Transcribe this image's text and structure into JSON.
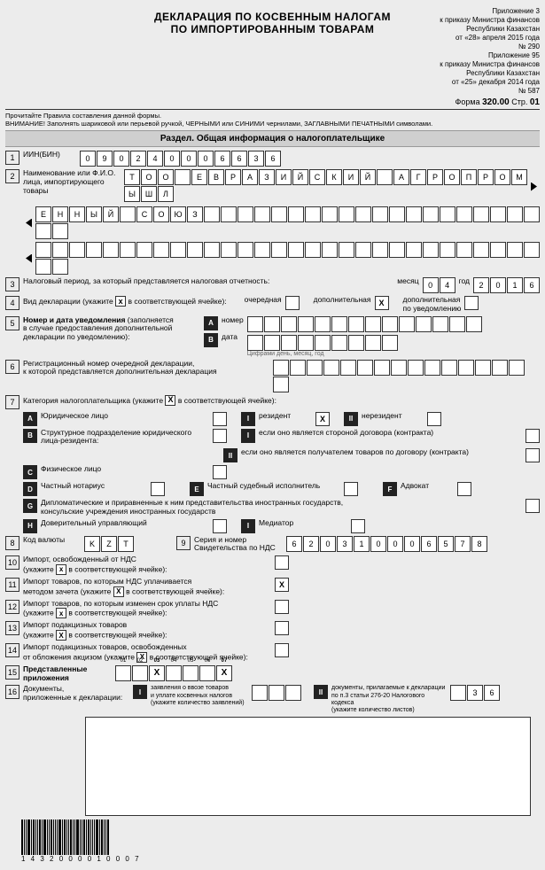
{
  "header": {
    "title_line1": "ДЕКЛАРАЦИЯ ПО КОСВЕННЫМ НАЛОГАМ",
    "title_line2": "ПО ИМПОРТИРОВАННЫМ ТОВАРАМ",
    "annex": "Приложение 3",
    "to1": "к приказу Министра финансов",
    "to2": "Республики Казахстан",
    "date1": "от «28» апреля 2015 года",
    "num1": "№ 290",
    "annex2": "Приложение 95",
    "to3": "к приказу Министра финансов",
    "to4": "Республики Казахстан",
    "date2": "от «25» декабря 2014 года",
    "num2": "№ 587",
    "form_label": "Форма",
    "form_code": "320.00",
    "page_label": "Стр.",
    "page": "01"
  },
  "notes": {
    "l1": "Прочитайте Правила составления данной формы.",
    "l2": "ВНИМАНИЕ! Заполнять шариковой или перьевой ручкой, ЧЕРНЫМИ или СИНИМИ чернилами, ЗАГЛАВНЫМИ ПЕЧАТНЫМИ символами."
  },
  "section": {
    "title": "Раздел. Общая информация о налогоплательщике"
  },
  "r1": {
    "label": "ИИН(БИН)",
    "v": [
      "0",
      "9",
      "0",
      "2",
      "4",
      "0",
      "0",
      "0",
      "6",
      "6",
      "3",
      "6"
    ]
  },
  "r2": {
    "label": "Наименование или Ф.И.О.",
    "sub": "лица, импортирующего товары",
    "line1": [
      "Т",
      "О",
      "О",
      "",
      "Е",
      "В",
      "Р",
      "А",
      "З",
      "И",
      "Й",
      "С",
      "К",
      "И",
      "Й",
      "",
      "А",
      "Г",
      "Р",
      "О",
      "П",
      "Р",
      "О",
      "М",
      "Ы",
      "Ш",
      "Л"
    ],
    "line2": [
      "Е",
      "Н",
      "Н",
      "Ы",
      "Й",
      "",
      "С",
      "О",
      "Ю",
      "З",
      "",
      "",
      "",
      "",
      "",
      "",
      "",
      "",
      "",
      "",
      "",
      "",
      "",
      "",
      "",
      "",
      "",
      "",
      "",
      "",
      "",
      ""
    ],
    "line3": [
      "",
      "",
      "",
      "",
      "",
      "",
      "",
      "",
      "",
      "",
      "",
      "",
      "",
      "",
      "",
      "",
      "",
      "",
      "",
      "",
      "",
      "",
      "",
      "",
      "",
      "",
      "",
      "",
      "",
      "",
      "",
      ""
    ]
  },
  "r3": {
    "label": "Налоговый период, за который представляется налоговая отчетность:",
    "month_lbl": "месяц",
    "month": [
      "0",
      "4"
    ],
    "year_lbl": "год",
    "year": [
      "2",
      "0",
      "1",
      "6"
    ]
  },
  "r4": {
    "label": "Вид декларации (укажите",
    "x": "x",
    "label2": "в соответствующей ячейке):",
    "o1": "очередная",
    "o2": "дополнительная",
    "o2v": "X",
    "o3": "дополнительная",
    "o3b": "по уведомлению"
  },
  "r5": {
    "label": "Номер и дата уведомления",
    "sub": "(заполняется",
    "sub2": "в случае предоставления дополнительной",
    "sub3": "декларации по уведомлению):",
    "A": "номер",
    "B": "дата",
    "cells_a": [
      "",
      "",
      "",
      "",
      "",
      "",
      "",
      "",
      "",
      "",
      "",
      "",
      "",
      ""
    ],
    "date_b": [
      "",
      "",
      "",
      "",
      "",
      "",
      "",
      "",
      ""
    ],
    "foot": "Цифрами день, месяц, год"
  },
  "r6": {
    "label": "Регистрационный номер очередной декларации,",
    "sub": "к которой представляется дополнительная декларация",
    "cells": [
      "",
      "",
      "",
      "",
      "",
      "",
      "",
      "",
      "",
      "",
      "",
      "",
      "",
      "",
      "",
      ""
    ]
  },
  "r7": {
    "label": "Категория налогоплательщика (укажите",
    "x": "X",
    "label2": "в соответствующей ячейке):"
  },
  "cat": {
    "A": "Юридическое лицо",
    "B": "Структурное подразделение юридического",
    "Bb": "лица-резидента:",
    "C": "Физическое лицо",
    "D": "Частный нотариус",
    "E": "Частный судебный исполнитель",
    "F": "Адвокат",
    "G": "Дипломатические и приравненные к ним представительства иностранных государств,",
    "Gb": "консульские учреждения иностранных государств",
    "H": "Доверительный управляющий",
    "I": "Медиатор",
    "I1": "резидент",
    "I1v": "X",
    "II1": "нерезидент",
    "I2": "если оно является стороной договора (контракта)",
    "II2": "если оно является получателем товаров по договору (контракта)"
  },
  "r8": {
    "label": "Код валюты",
    "v": [
      "K",
      "Z",
      "T"
    ]
  },
  "r9": {
    "num": "9",
    "label1": "Серия и номер",
    "label2": "Свидетельства по НДС",
    "v": [
      "6",
      "2",
      "0",
      "3",
      "1",
      "0",
      "0",
      "0",
      "6",
      "5",
      "7",
      "8"
    ]
  },
  "r10": {
    "label": "Импорт, освобожденный от НДС",
    "sub": "(укажите",
    "x": "x",
    "sub2": "в соответствующей ячейке):"
  },
  "r11": {
    "label": "Импорт товаров, по которым НДС уплачивается",
    "sub": "методом зачета (укажите",
    "x": "X",
    "sub2": "в соответствующей ячейке):",
    "v": "X"
  },
  "r12": {
    "label": "Импорт товаров, по которым изменен срок уплаты НДС",
    "sub": "(укажите",
    "x": "x",
    "sub2": "в соответствующей ячейке):"
  },
  "r13": {
    "label": "Импорт подакцизных товаров",
    "sub": "(укажите",
    "x": "X",
    "sub2": "в соответствующей ячейке):"
  },
  "r14": {
    "label": "Импорт подакцизных товаров, освобожденных",
    "sub": "от обложения акцизом (укажите",
    "x": "X",
    "sub2": "в соответствующей ячейке):"
  },
  "r15": {
    "label": "Представленные",
    "sub": "приложения",
    "v": [
      "01",
      "02",
      "X",
      "04",
      "05",
      "06",
      "X"
    ],
    "idx": [
      "01",
      "02",
      "03",
      "04",
      "05",
      "06",
      "07"
    ]
  },
  "r16": {
    "label": "Документы,",
    "sub": "приложенные к декларации:",
    "I": "заявления о ввозе товаров",
    "Ib": "и уплате косвенных налогов",
    "Ic": "(укажите количество заявлений)",
    "II": "документы, прилагаемые к декларации",
    "IIb": "по п.3 статьи 276-20 Налогового кодекса",
    "IIc": "(укажите количество листов)",
    "v2": [
      "",
      "3",
      "6"
    ]
  },
  "barcode": "1 4 3 2 0 0 0 0 1 0 0 0 7"
}
